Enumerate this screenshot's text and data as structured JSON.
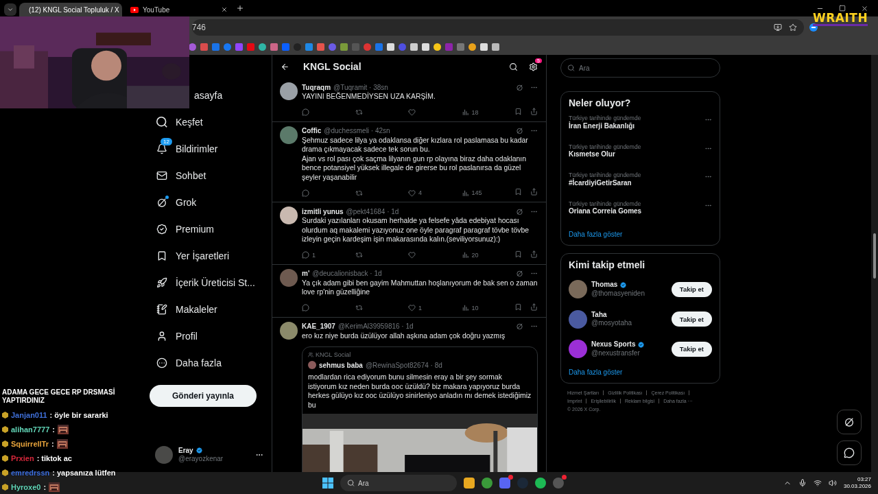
{
  "browser": {
    "tabs": [
      {
        "title": "(12) KNGL Social Topluluk / X",
        "selected": true
      },
      {
        "title": "YouTube",
        "selected": false
      }
    ],
    "address": "746"
  },
  "overlay": {
    "logo": "WRAITH",
    "chat_title": "ADAMA GECE GECE RP DRSMASİ YAPTIRDINIZ",
    "chat": [
      {
        "user": "Janjan011",
        "color": "#3f6fd8",
        "kind": "text",
        "text": ": öyle bir sararki"
      },
      {
        "user": "alihan7777",
        "color": "#62d6b8",
        "kind": "emote",
        "text": ":"
      },
      {
        "user": "SquirrellTr",
        "color": "#e9a53c",
        "kind": "emote",
        "text": ":"
      },
      {
        "user": "Prxien",
        "color": "#d9283c",
        "kind": "text",
        "text": ": tiktok ac"
      },
      {
        "user": "emredrssn",
        "color": "#3d6fe0",
        "kind": "text",
        "text": ": yapsanıza lütfen"
      },
      {
        "user": "Hyroxe0",
        "color": "#62d6b8",
        "kind": "emote",
        "text": ":"
      }
    ]
  },
  "nav": {
    "items": [
      {
        "label": "asayfa",
        "covered": true
      },
      {
        "label": "Keşfet",
        "covered": false,
        "unread": false
      },
      {
        "label": "Bildirimler",
        "covered": false,
        "unread": false,
        "badge": "12"
      },
      {
        "label": "Sohbet",
        "covered": false,
        "unread": false
      },
      {
        "label": "Grok",
        "covered": false,
        "unread": true
      },
      {
        "label": "Premium",
        "covered": false,
        "unread": false
      },
      {
        "label": "Yer İşaretleri",
        "covered": false,
        "unread": false
      },
      {
        "label": "İçerik Üreticisi St...",
        "covered": false,
        "unread": false
      },
      {
        "label": "Makaleler",
        "covered": false,
        "unread": false
      },
      {
        "label": "Profil",
        "covered": false,
        "unread": false
      },
      {
        "label": "Daha fazla",
        "covered": false,
        "unread": false
      }
    ],
    "post_button": "Gönderi yayınla",
    "account": {
      "name": "Eray",
      "handle": "@erayozkenar",
      "verified": true
    }
  },
  "timeline": {
    "title": "KNGL Social",
    "settings_badge": "5",
    "posts": [
      {
        "author": "Tuqraqm",
        "meta": "@Tuqramit · 38sn",
        "text": "YAYINI BEĞENMEDİYSEN UZA KARŞİM.",
        "views": "18"
      },
      {
        "author": "Coffic",
        "meta": "@duchessmeli · 42sn",
        "text": "Şehmuz sadece lilya ya odaklansa diğer kızlara rol paslamasa bu kadar drama çıkmayacak sadece tek sorun bu.\nAjan vs rol pası çok saçma lilyanın gun rp olayına biraz daha odaklanın bence potansiyel yüksek illegale de girerse bu rol paslanırsa da güzel şeyler yaşanabilir",
        "likes": "4",
        "views": "145"
      },
      {
        "author": "izmitli yunus",
        "meta": "@pekt41684 · 1d",
        "text": "Surdaki yazılanları okusam herhalde ya felsefe yâda edebiyat hocası olurdum aq makalemi yazıyonuz one öyle paragraf paragraf tövbe tövbe izleyin geçin kardeşim işin makarasında kalın.(seviliyorsunuz):)",
        "replies": "1",
        "views": "20"
      },
      {
        "author": "m'",
        "meta": "@deucalionisback · 1d",
        "text": "Ya çık adam gibi ben gayim Mahmuttan hoşlanıyorum de bak sen o zaman love rp'nin güzelliğine",
        "likes": "1",
        "views": "10"
      },
      {
        "author": "KAE_1907",
        "meta": "@KerimAl39959816 · 1d",
        "text": "ero kız niye burda üzülüyor allah aşkına adam çok doğru yazmış",
        "quote": {
          "community": "KNGL Social",
          "author": "sehmus baba",
          "meta": "@RewinaSpot82674 · 8d",
          "text": "modlardan rica ediyorum bunu silmesin eray a bir şey sormak istiyorum kız neden burda ooc üzüldü? biz makara yapıyoruz burda herkes gülüyo kız ooc üzülüyo sinirleniyo anladın mı demek istediğimiz bu"
        }
      }
    ]
  },
  "sidebar": {
    "search_placeholder": "Ara",
    "trends_title": "Neler oluyor?",
    "trends": [
      {
        "context": "Türkiye tarihinde gündemde",
        "name": "İran Enerji Bakanlığı"
      },
      {
        "context": "Türkiye tarihinde gündemde",
        "name": "Kısmetse Olur"
      },
      {
        "context": "Türkiye tarihinde gündemde",
        "name": "#İcardiyiGetirSaran"
      },
      {
        "context": "Türkiye tarihinde gündemde",
        "name": "Oriana Correia Gomes"
      }
    ],
    "trends_more": "Daha fazla göster",
    "follow_title": "Kimi takip etmeli",
    "people": [
      {
        "name": "Thomas",
        "handle": "@thomasyeniden",
        "verified": true,
        "button": "Takip et"
      },
      {
        "name": "Taha",
        "handle": "@mosyotaha",
        "verified": false,
        "button": "Takip et"
      },
      {
        "name": "Nexus Sports",
        "handle": "@nexustransfer",
        "verified": true,
        "button": "Takip et"
      }
    ],
    "follow_more": "Daha fazla göster",
    "footer_links": [
      "Hizmet Şartları",
      "Gizlilik Politikası",
      "Çerez Politikası",
      "Imprint",
      "Erişilebilirlik",
      "Reklam bilgisi",
      "Daha fazla ···"
    ],
    "copyright": "© 2026 X Corp."
  },
  "taskbar": {
    "search_placeholder": "Ara",
    "time": "03:27",
    "date": "30.03.2026"
  }
}
